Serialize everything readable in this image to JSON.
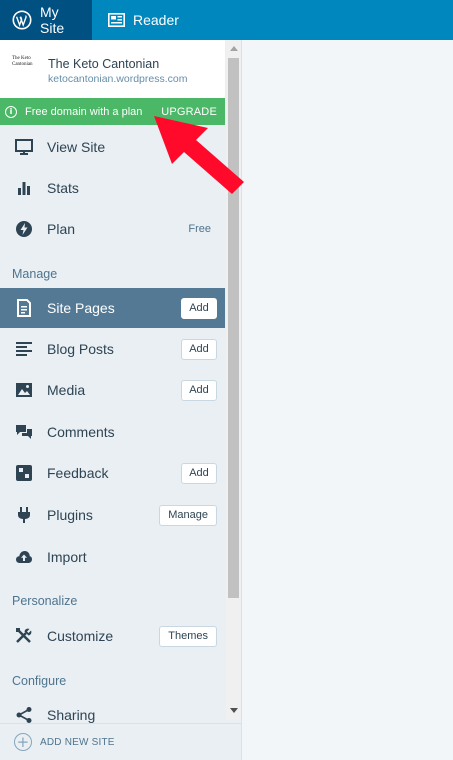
{
  "topbar": {
    "my_site_label": "My Site",
    "reader_label": "Reader"
  },
  "site": {
    "logo_text": "The Keto Cantonian",
    "title": "The Keto Cantonian",
    "url": "ketocantonian.wordpress.com"
  },
  "promo": {
    "text": "Free domain with a plan",
    "action": "UPGRADE",
    "color": "#4ab866"
  },
  "nav": {
    "view_site": "View Site",
    "stats": "Stats",
    "plan": "Plan",
    "plan_badge": "Free",
    "manage_header": "Manage",
    "site_pages": "Site Pages",
    "blog_posts": "Blog Posts",
    "media": "Media",
    "comments": "Comments",
    "feedback": "Feedback",
    "plugins": "Plugins",
    "import": "Import",
    "personalize_header": "Personalize",
    "customize": "Customize",
    "configure_header": "Configure",
    "sharing": "Sharing"
  },
  "buttons": {
    "add": "Add",
    "manage": "Manage",
    "themes": "Themes"
  },
  "footer": {
    "add_new_site": "ADD NEW SITE"
  },
  "colors": {
    "topbar": "#0087be",
    "topbar_active": "#005082",
    "selected_item": "#537994",
    "annotation_arrow": "#ff0a2a"
  }
}
